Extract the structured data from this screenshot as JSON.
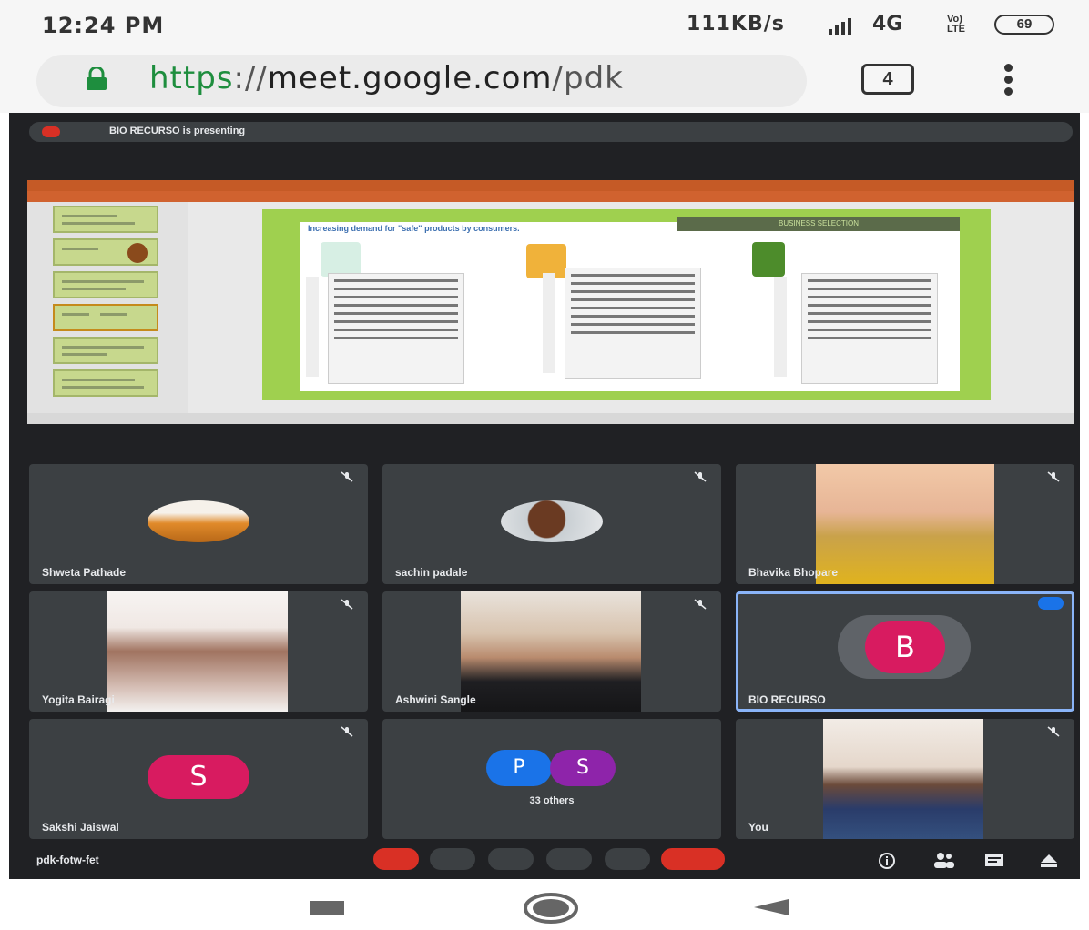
{
  "status_bar": {
    "time": "12:24 PM",
    "network_speed": "111KB/s",
    "network_type": "4G",
    "volte": "Vo) LTE",
    "battery": "69"
  },
  "browser": {
    "url_scheme": "https",
    "url_sep": "://",
    "url_host": "meet.google.com",
    "url_path": "/pdk",
    "tab_count": "4"
  },
  "meet": {
    "presenting_label": "BIO RECURSO is presenting",
    "slide": {
      "title": "Increasing demand for \"safe\" products by consumers.",
      "banner": "BUSINESS SELECTION"
    },
    "participants": [
      {
        "name": "Shweta Pathade"
      },
      {
        "name": "sachin padale"
      },
      {
        "name": "Bhavika Bhopare"
      },
      {
        "name": "Yogita Bairagi"
      },
      {
        "name": "Ashwini Sangle"
      },
      {
        "name": "BIO RECURSO",
        "initial": "B"
      },
      {
        "name": "Sakshi Jaiswal",
        "initial": "S"
      },
      {
        "others_count": "33 others",
        "initials": [
          "P",
          "S"
        ]
      },
      {
        "name": "You"
      }
    ],
    "meeting_code": "pdk-fotw-fet"
  },
  "colors": {
    "meet_bg": "#202124",
    "tile_bg": "#3c4043",
    "accent_red": "#d93025",
    "avatar_pink": "#d81b60",
    "avatar_blue": "#1a73e8",
    "avatar_purple": "#8e24aa",
    "url_green": "#1e8e3e",
    "ppt_orange": "#c55a26",
    "slide_green": "#9fd04f"
  },
  "icons": [
    "lock-icon",
    "tabs-icon",
    "more-vert-icon",
    "mic-off-icon",
    "camera-icon",
    "captions-icon",
    "present-icon",
    "more-icon",
    "hangup-icon",
    "info-icon",
    "people-icon",
    "chat-icon",
    "activities-icon",
    "recents-nav-icon",
    "home-nav-icon",
    "back-nav-icon"
  ]
}
